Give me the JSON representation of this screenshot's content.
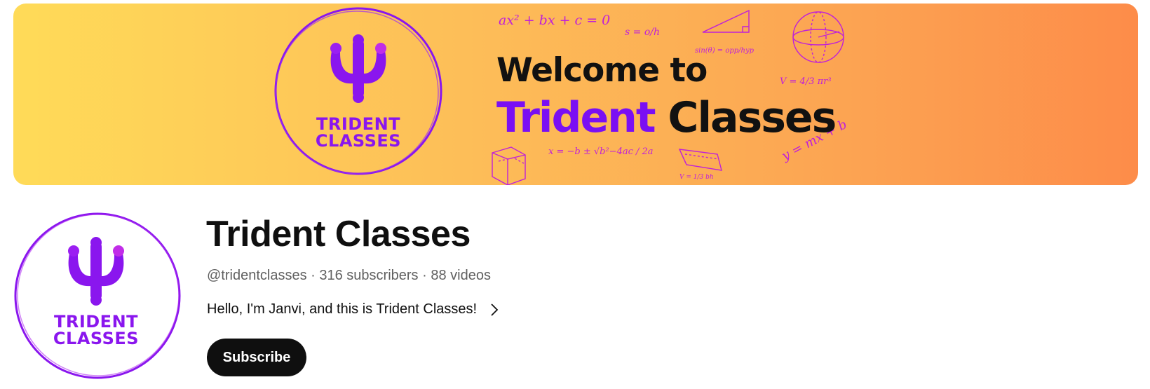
{
  "banner": {
    "welcome": "Welcome to",
    "title_brand": "Trident",
    "title_rest": "Classes",
    "logo_line1": "TRIDENT",
    "logo_line2": "CLASSES",
    "formulas": {
      "quadratic": "ax² + bx + c = 0",
      "sin_ratio": "s = o/h",
      "sin_theta": "sin(θ) = opp/hyp",
      "sphere_volume": "V = 4/3 πr³",
      "quadratic_formula": "x = −b ± √b²−4ac / 2a",
      "line": "y = mx + b",
      "prism_volume": "V = 1/3 bh"
    },
    "colors": {
      "gradient_start": "#ffdb58",
      "gradient_end": "#fd8c49",
      "brand_purple": "#7a0ff3",
      "doodle_magenta": "#c020d8"
    }
  },
  "avatar": {
    "logo_line1": "TRIDENT",
    "logo_line2": "CLASSES"
  },
  "channel": {
    "name": "Trident Classes",
    "handle": "@tridentclasses",
    "separator": " · ",
    "subscribers": "316 subscribers",
    "videos": "88 videos",
    "description": "Hello, I'm Janvi, and this is Trident Classes!",
    "subscribe_label": "Subscribe"
  },
  "icons": {
    "description_more": "chevron-right-icon",
    "logo_mark": "trident-icon"
  }
}
